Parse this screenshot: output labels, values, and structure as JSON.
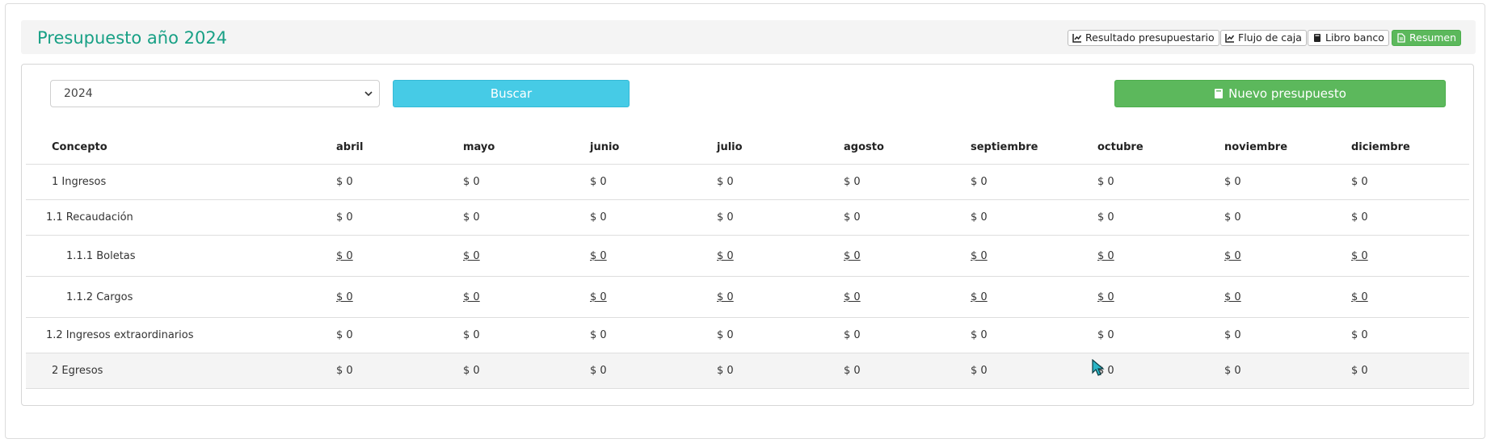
{
  "page": {
    "title": "Presupuesto año 2024"
  },
  "top_buttons": {
    "resultado": "Resultado presupuestario",
    "flujo": "Flujo de caja",
    "libro": "Libro banco",
    "resumen": "Resumen"
  },
  "filters": {
    "year": "2024",
    "search_label": "Buscar",
    "new_label": "Nuevo presupuesto"
  },
  "table": {
    "headers": [
      "Concepto",
      "abril",
      "mayo",
      "junio",
      "julio",
      "agosto",
      "septiembre",
      "octubre",
      "noviembre",
      "diciembre"
    ],
    "rows": [
      {
        "concept": "1 Ingresos",
        "values": [
          "$ 0",
          "$ 0",
          "$ 0",
          "$ 0",
          "$ 0",
          "$ 0",
          "$ 0",
          "$ 0",
          "$ 0"
        ]
      },
      {
        "concept": "1.1 Recaudación",
        "values": [
          "$ 0",
          "$ 0",
          "$ 0",
          "$ 0",
          "$ 0",
          "$ 0",
          "$ 0",
          "$ 0",
          "$ 0"
        ]
      },
      {
        "concept": "1.1.1 Boletas",
        "values": [
          "$ 0",
          "$ 0",
          "$ 0",
          "$ 0",
          "$ 0",
          "$ 0",
          "$ 0",
          "$ 0",
          "$ 0"
        ]
      },
      {
        "concept": "1.1.2 Cargos",
        "values": [
          "$ 0",
          "$ 0",
          "$ 0",
          "$ 0",
          "$ 0",
          "$ 0",
          "$ 0",
          "$ 0",
          "$ 0"
        ]
      },
      {
        "concept": "1.2 Ingresos extraordinarios",
        "values": [
          "$ 0",
          "$ 0",
          "$ 0",
          "$ 0",
          "$ 0",
          "$ 0",
          "$ 0",
          "$ 0",
          "$ 0"
        ]
      },
      {
        "concept": "2 Egresos",
        "values": [
          "$ 0",
          "$ 0",
          "$ 0",
          "$ 0",
          "$ 0",
          "$ 0",
          "$ 0",
          "$ 0",
          "$ 0"
        ]
      }
    ]
  },
  "colors": {
    "title": "#17a085",
    "search": "#46cbe6",
    "green": "#5cb85c"
  },
  "icons": {
    "chart": "chart-icon",
    "book": "book-icon",
    "document": "document-icon",
    "chevron": "chevron-down-icon"
  }
}
